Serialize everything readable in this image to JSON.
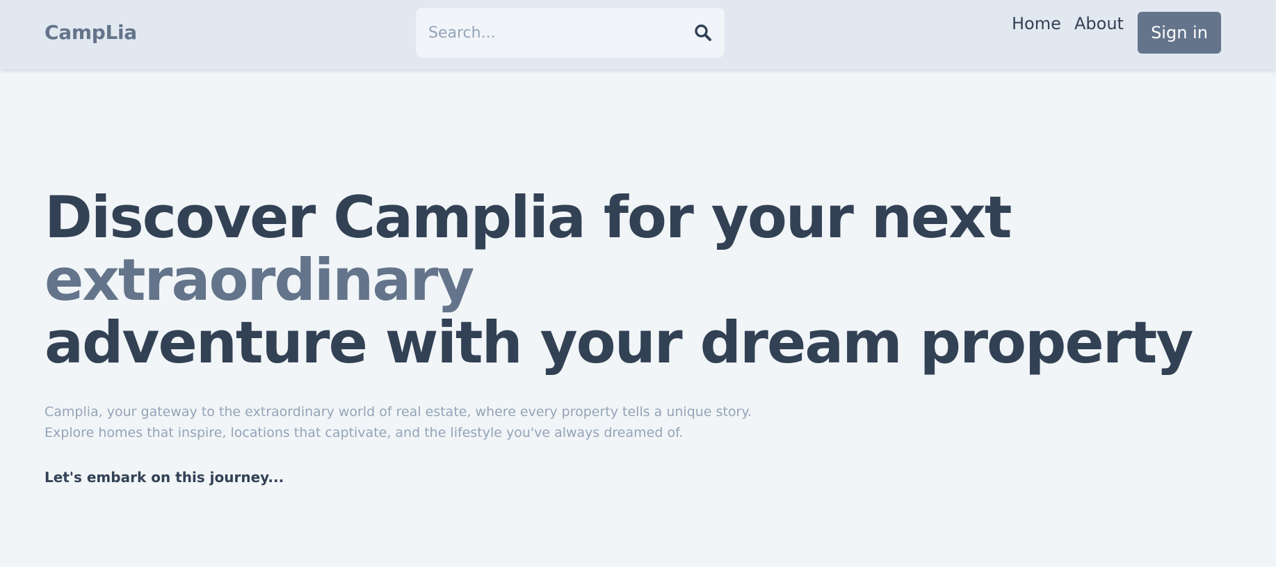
{
  "navbar": {
    "brand": "CampLia",
    "search": {
      "placeholder": "Search...",
      "value": "",
      "icon": "search-icon"
    },
    "links": [
      {
        "label": "Home"
      },
      {
        "label": "About"
      }
    ],
    "signin_label": "Sign in"
  },
  "hero": {
    "title_line1": "Discover Camplia for your next",
    "title_line2": "extraordinary",
    "title_line3": "adventure with your dream property",
    "description_line1": "Camplia, your gateway to the extraordinary world of real estate, where every property tells a unique story.",
    "description_line2": "Explore homes that inspire, locations that captivate, and the lifestyle you've always dreamed of.",
    "cta": "Let's embark on this journey..."
  },
  "colors": {
    "page_background": "#f1f5f7",
    "navbar_background": "#e2e8f0",
    "primary_text": "#334155",
    "accent": "#64748b",
    "muted_text": "#94a3b8",
    "search_background": "#f1f5f9",
    "button_text": "#ffffff"
  }
}
